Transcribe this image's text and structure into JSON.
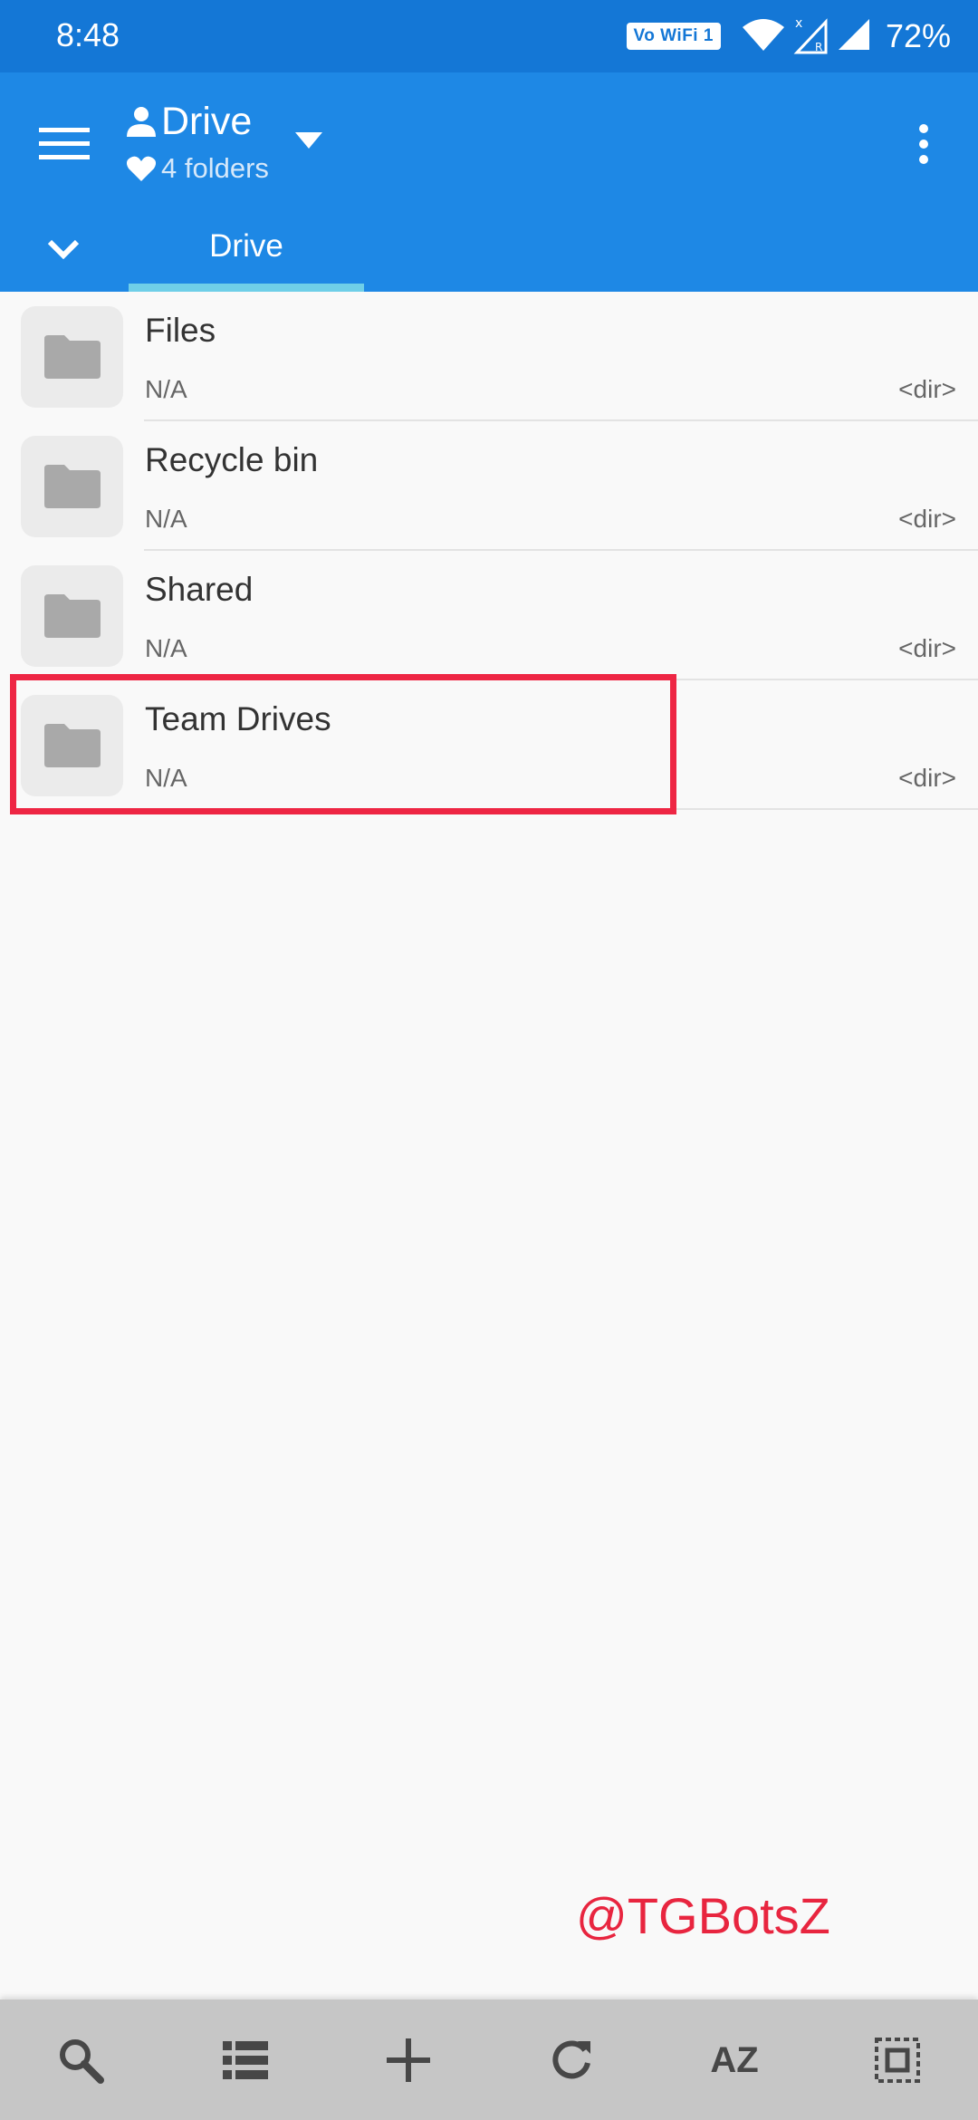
{
  "status_bar": {
    "time": "8:48",
    "network_badge": "Vo WiFi 1",
    "battery": "72%"
  },
  "app_bar": {
    "title": "Drive",
    "subtitle": "4 folders",
    "tab_label": "Drive"
  },
  "items": [
    {
      "name": "Files",
      "meta": "N/A",
      "type": "<dir>"
    },
    {
      "name": "Recycle bin",
      "meta": "N/A",
      "type": "<dir>"
    },
    {
      "name": "Shared",
      "meta": "N/A",
      "type": "<dir>"
    },
    {
      "name": "Team Drives",
      "meta": "N/A",
      "type": "<dir>"
    }
  ],
  "highlighted_item": "Team Drives",
  "watermark": "@TGBotsZ",
  "bottom_bar": {
    "sort_label": "AZ"
  },
  "colors": {
    "status_bar": "#1477d6",
    "app_bar": "#1e88e5",
    "tab_indicator": "#6fcfe8",
    "highlight": "#ee2644",
    "bottom_bar": "#c6c6c6"
  }
}
